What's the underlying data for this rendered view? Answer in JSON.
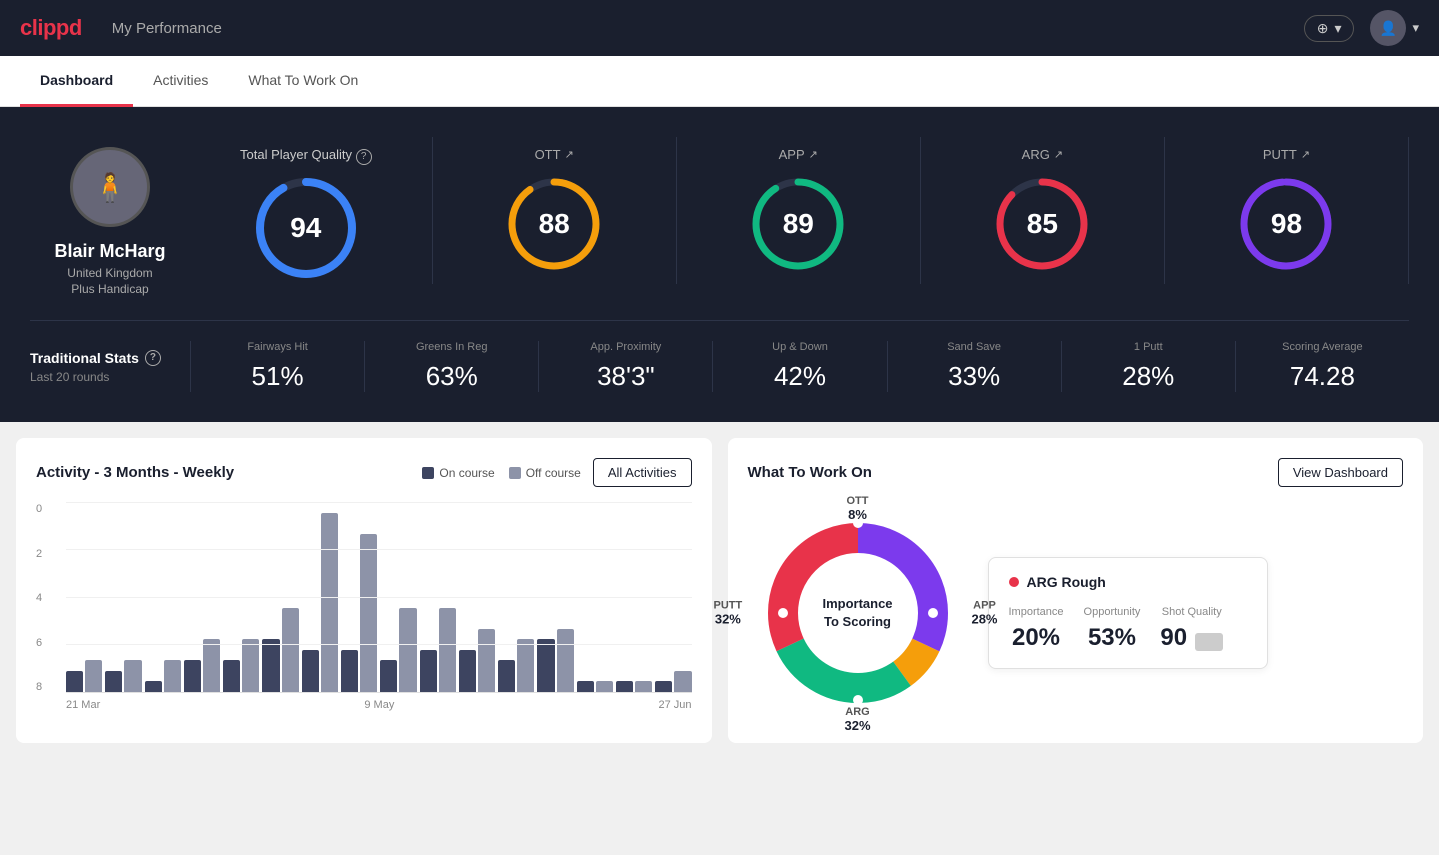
{
  "app": {
    "logo": "clippd",
    "header_title": "My Performance"
  },
  "nav": {
    "tabs": [
      {
        "label": "Dashboard",
        "active": true
      },
      {
        "label": "Activities",
        "active": false
      },
      {
        "label": "What To Work On",
        "active": false
      }
    ]
  },
  "player": {
    "name": "Blair McHarg",
    "country": "United Kingdom",
    "handicap": "Plus Handicap",
    "avatar_emoji": "🧍"
  },
  "tpq": {
    "label": "Total Player Quality",
    "value": 94,
    "color": "#3b82f6"
  },
  "metrics": [
    {
      "label": "OTT",
      "value": 88,
      "color": "#f59e0b"
    },
    {
      "label": "APP",
      "value": 89,
      "color": "#10b981"
    },
    {
      "label": "ARG",
      "value": 85,
      "color": "#e8334a"
    },
    {
      "label": "PUTT",
      "value": 98,
      "color": "#7c3aed"
    }
  ],
  "trad_stats": {
    "title": "Traditional Stats",
    "subtitle": "Last 20 rounds",
    "items": [
      {
        "label": "Fairways Hit",
        "value": "51%"
      },
      {
        "label": "Greens In Reg",
        "value": "63%"
      },
      {
        "label": "App. Proximity",
        "value": "38'3\""
      },
      {
        "label": "Up & Down",
        "value": "42%"
      },
      {
        "label": "Sand Save",
        "value": "33%"
      },
      {
        "label": "1 Putt",
        "value": "28%"
      },
      {
        "label": "Scoring Average",
        "value": "74.28"
      }
    ]
  },
  "activity_chart": {
    "title": "Activity - 3 Months - Weekly",
    "legend_on": "On course",
    "legend_off": "Off course",
    "all_activities_btn": "All Activities",
    "y_labels": [
      "0",
      "2",
      "4",
      "6",
      "8"
    ],
    "x_labels": [
      "21 Mar",
      "9 May",
      "27 Jun"
    ],
    "bars": [
      {
        "on": 1,
        "off": 1.5
      },
      {
        "on": 1,
        "off": 1.5
      },
      {
        "on": 0.5,
        "off": 1.5
      },
      {
        "on": 1.5,
        "off": 2.5
      },
      {
        "on": 1.5,
        "off": 2.5
      },
      {
        "on": 2.5,
        "off": 4
      },
      {
        "on": 2,
        "off": 8.5
      },
      {
        "on": 2,
        "off": 7.5
      },
      {
        "on": 1.5,
        "off": 4
      },
      {
        "on": 2,
        "off": 4
      },
      {
        "on": 2,
        "off": 3
      },
      {
        "on": 1.5,
        "off": 2.5
      },
      {
        "on": 2.5,
        "off": 3
      },
      {
        "on": 0.5,
        "off": 0.5
      },
      {
        "on": 0.5,
        "off": 0.5
      },
      {
        "on": 0.5,
        "off": 1
      }
    ]
  },
  "what_to_work": {
    "title": "What To Work On",
    "view_dashboard_btn": "View Dashboard",
    "donut_center": "Importance\nTo Scoring",
    "segments": [
      {
        "label": "OTT",
        "value": "8%",
        "color": "#f59e0b",
        "position": "top"
      },
      {
        "label": "APP",
        "value": "28%",
        "color": "#10b981",
        "position": "right"
      },
      {
        "label": "ARG",
        "value": "32%",
        "color": "#e8334a",
        "position": "bottom"
      },
      {
        "label": "PUTT",
        "value": "32%",
        "color": "#7c3aed",
        "position": "left"
      }
    ],
    "info_card": {
      "title": "ARG Rough",
      "dot_color": "#e8334a",
      "metrics": [
        {
          "label": "Importance",
          "value": "20%"
        },
        {
          "label": "Opportunity",
          "value": "53%"
        },
        {
          "label": "Shot Quality",
          "value": "90"
        }
      ]
    }
  },
  "header_buttons": {
    "add_label": "+ ▾",
    "avatar_label": "▾"
  }
}
